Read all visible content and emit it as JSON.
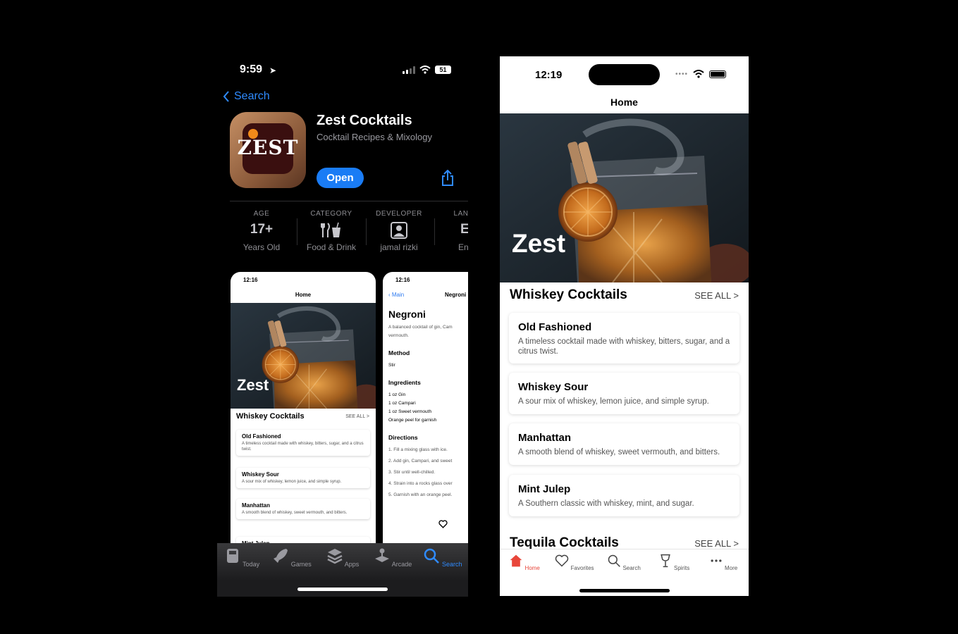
{
  "left_phone": {
    "status": {
      "time": "9:59",
      "battery": "51"
    },
    "back_label": "Search",
    "app": {
      "name": "Zest Cocktails",
      "subtitle": "Cocktail Recipes & Mixology",
      "icon_text": "ZEST",
      "open_label": "Open"
    },
    "stats": [
      {
        "header": "AGE",
        "value": "17+",
        "sub": "Years Old"
      },
      {
        "header": "CATEGORY",
        "value": "",
        "sub": "Food & Drink",
        "icon": "fork-knife-cup-icon"
      },
      {
        "header": "DEVELOPER",
        "value": "",
        "sub": "jamal rizki",
        "icon": "person-icon"
      },
      {
        "header": "LANGU",
        "value": "EI",
        "sub": "Engl"
      }
    ],
    "screenshot1": {
      "time": "12:16",
      "title": "Home",
      "brand": "Zest",
      "section": "Whiskey Cocktails",
      "see_all": "SEE ALL >",
      "cards": [
        {
          "title": "Old Fashioned",
          "desc": "A timeless cocktail made with whiskey, bitters, sugar, and a citrus twist."
        },
        {
          "title": "Whiskey Sour",
          "desc": "A sour mix of whiskey, lemon juice, and simple syrup."
        },
        {
          "title": "Manhattan",
          "desc": "A smooth blend of whiskey, sweet vermouth, and bitters."
        },
        {
          "title": "Mint Julep",
          "desc": ""
        }
      ]
    },
    "screenshot2": {
      "time": "12:16",
      "back": "Main",
      "header": "Negroni",
      "title": "Negroni",
      "desc1": "A balanced cocktail of gin, Cam",
      "desc2": "vermouth.",
      "method_label": "Method",
      "method": "Stir",
      "ingredients_label": "Ingredients",
      "ingredients": [
        "1 oz Gin",
        "1 oz Campari",
        "1 oz Sweet vermouth",
        "Orange peel for garnish"
      ],
      "directions_label": "Directions",
      "directions": [
        "1. Fill a mixing glass with ice.",
        "2. Add gin, Campari, and sweet",
        "3. Stir until well-chilled.",
        "4. Strain into a rocks glass over",
        "5. Garnish with an orange peel."
      ]
    },
    "tabs": [
      {
        "label": "Today",
        "icon": "today-icon"
      },
      {
        "label": "Games",
        "icon": "rocket-icon"
      },
      {
        "label": "Apps",
        "icon": "apps-stack-icon"
      },
      {
        "label": "Arcade",
        "icon": "joystick-icon"
      },
      {
        "label": "Search",
        "icon": "search-icon",
        "active": true
      }
    ],
    "colors": {
      "accent": "#2f8bff",
      "open_button": "#1a7cf5"
    }
  },
  "right_phone": {
    "status": {
      "time": "12:19"
    },
    "nav_title": "Home",
    "brand": "Zest",
    "sections": [
      {
        "title": "Whiskey Cocktails",
        "see_all": "SEE ALL >"
      },
      {
        "title": "Tequila Cocktails",
        "see_all": "SEE ALL >"
      }
    ],
    "cards": [
      {
        "title": "Old Fashioned",
        "desc": "A timeless cocktail made with whiskey, bitters, sugar, and a citrus twist."
      },
      {
        "title": "Whiskey Sour",
        "desc": "A sour mix of whiskey, lemon juice, and simple syrup."
      },
      {
        "title": "Manhattan",
        "desc": "A smooth blend of whiskey, sweet vermouth, and bitters."
      },
      {
        "title": "Mint Julep",
        "desc": "A Southern classic with whiskey, mint, and sugar."
      }
    ],
    "tabs": [
      {
        "label": "Home",
        "icon": "home-icon",
        "active": true
      },
      {
        "label": "Favorites",
        "icon": "heart-icon"
      },
      {
        "label": "Search",
        "icon": "search-icon"
      },
      {
        "label": "Spirits",
        "icon": "cocktail-glass-icon"
      },
      {
        "label": "More",
        "icon": "more-dots-icon"
      }
    ],
    "colors": {
      "active_tab": "#e8463a"
    }
  }
}
